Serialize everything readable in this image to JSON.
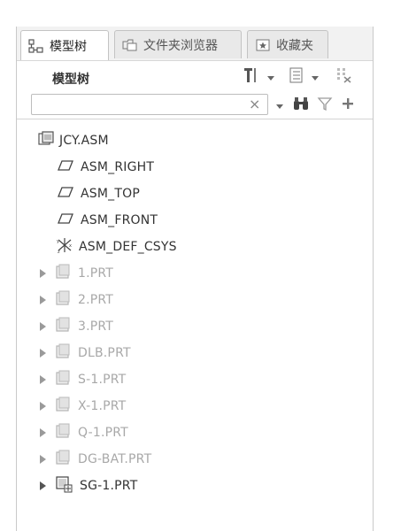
{
  "tabs": [
    {
      "label": "模型树",
      "active": true,
      "icon": "model-tree-icon"
    },
    {
      "label": "文件夹浏览器",
      "active": false,
      "icon": "folder-browser-icon"
    },
    {
      "label": "收藏夹",
      "active": false,
      "icon": "favorites-icon"
    }
  ],
  "header": {
    "title": "模型树"
  },
  "search": {
    "value": "",
    "clear_glyph": "×"
  },
  "tree": {
    "root": {
      "label": "JCY.ASM",
      "icon": "assembly-icon"
    },
    "datums": [
      {
        "label": "ASM_RIGHT",
        "icon": "datum-plane-icon"
      },
      {
        "label": "ASM_TOP",
        "icon": "datum-plane-icon"
      },
      {
        "label": "ASM_FRONT",
        "icon": "datum-plane-icon"
      },
      {
        "label": "ASM_DEF_CSYS",
        "icon": "coordinate-system-icon"
      }
    ],
    "parts": [
      {
        "label": "1.PRT",
        "dim": true
      },
      {
        "label": "2.PRT",
        "dim": true
      },
      {
        "label": "3.PRT",
        "dim": true
      },
      {
        "label": "DLB.PRT",
        "dim": true
      },
      {
        "label": "S-1.PRT",
        "dim": true
      },
      {
        "label": "X-1.PRT",
        "dim": true
      },
      {
        "label": "Q-1.PRT",
        "dim": true
      },
      {
        "label": "DG-BAT.PRT",
        "dim": true
      },
      {
        "label": "SG-1.PRT",
        "dim": false
      }
    ]
  },
  "colors": {
    "active_text": "#333333",
    "dim_text": "#a8a8a8",
    "border": "#c9c9c9"
  }
}
